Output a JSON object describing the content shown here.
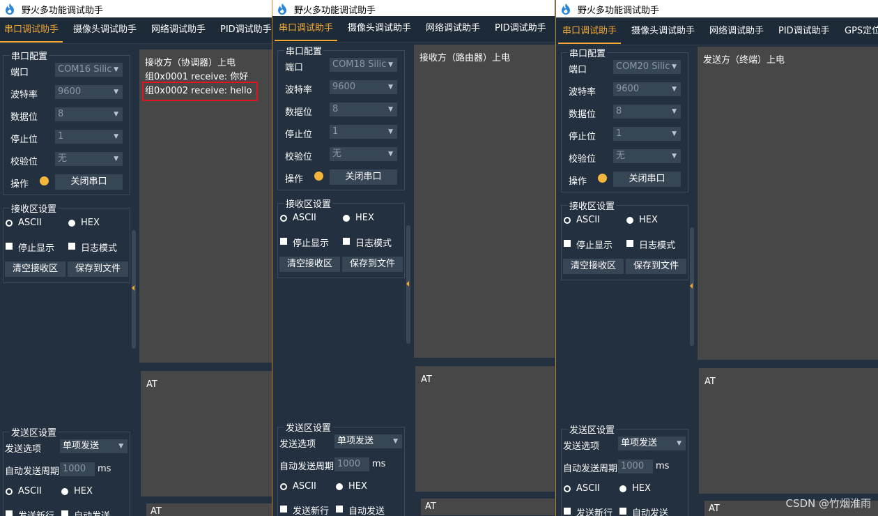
{
  "app_title": "野火多功能调试助手",
  "tabs": [
    "串口调试助手",
    "摄像头调试助手",
    "网络调试助手",
    "PID调试助手",
    "GPS定位"
  ],
  "labels": {
    "serial_config": "串口配置",
    "port": "端口",
    "baud": "波特率",
    "databits": "数据位",
    "stopbits": "停止位",
    "parity": "校验位",
    "operation": "操作",
    "close_port": "关闭串口",
    "recv_settings": "接收区设置",
    "ascii": "ASCII",
    "hex": "HEX",
    "stop_display": "停止显示",
    "log_mode": "日志模式",
    "clear_recv": "清空接收区",
    "save_file": "保存到文件",
    "send_settings": "发送区设置",
    "send_option": "发送选项",
    "send_option_value": "单项发送",
    "auto_period": "自动发送周期",
    "ms": "ms",
    "send_newline": "发送新行",
    "auto_send": "自动发送"
  },
  "windows": [
    {
      "port": "COM16 Silic",
      "baud": "9600",
      "databits": "8",
      "stopbits": "1",
      "parity": "无",
      "recv_lines": [
        "接收方（协调器）上电",
        "组0x0001 receive: 你好",
        "组0x0002 receive: hello"
      ],
      "send_text": "AT",
      "send_line": "AT",
      "period": "1000"
    },
    {
      "port": "COM18 Silic",
      "baud": "9600",
      "databits": "8",
      "stopbits": "1",
      "parity": "无",
      "recv_lines": [
        "接收方（路由器）上电"
      ],
      "send_text": "AT",
      "send_line": "AT",
      "period": "1000"
    },
    {
      "port": "COM20 Silic",
      "baud": "9600",
      "databits": "8",
      "stopbits": "1",
      "parity": "无",
      "recv_lines": [
        "发送方（终端）上电"
      ],
      "send_text": "AT",
      "send_line": "AT",
      "period": "1000"
    }
  ],
  "watermark": "CSDN @竹烟淮雨",
  "colors": {
    "background": "#22303f",
    "accent": "#f3a833",
    "highlight_box": "#e0141e",
    "textarea": "#474747"
  }
}
